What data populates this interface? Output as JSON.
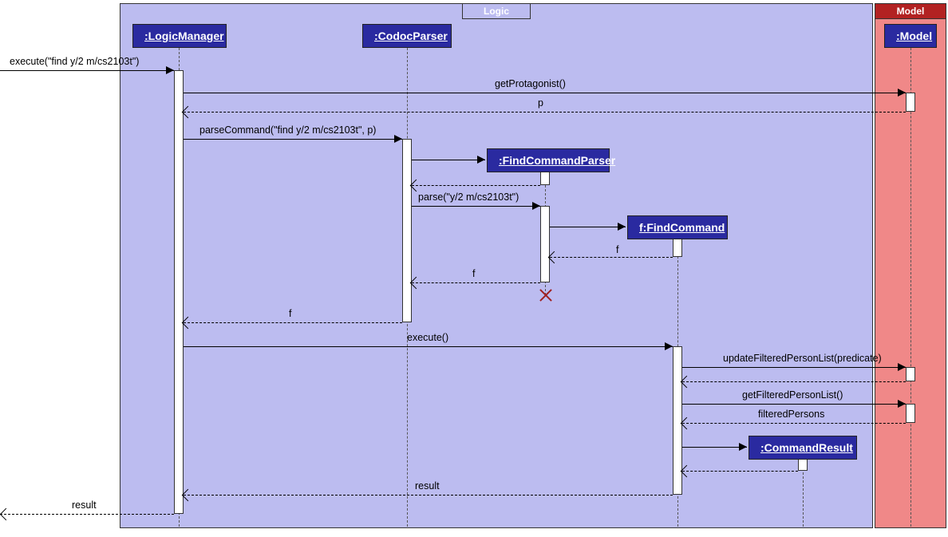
{
  "frames": {
    "logic": "Logic",
    "model": "Model"
  },
  "participants": {
    "logicManager": ":LogicManager",
    "codocParser": ":CodocParser",
    "findCommandParser": ":FindCommandParser",
    "findCommand": "f:FindCommand",
    "commandResult": ":CommandResult",
    "model": ":Model"
  },
  "messages": {
    "execute_in": "execute(\"find y/2 m/cs2103t\")",
    "getProtagonist": "getProtagonist()",
    "p": "p",
    "parseCommand": "parseCommand(\"find y/2 m/cs2103t\", p)",
    "parse": "parse(\"y/2 m/cs2103t\")",
    "f1": "f",
    "f2": "f",
    "f3": "f",
    "execute": "execute()",
    "updateFilteredPersonList": "updateFilteredPersonList(predicate)",
    "getFilteredPersonList": "getFilteredPersonList()",
    "filteredPersons": "filteredPersons",
    "result1": "result",
    "result2": "result"
  }
}
